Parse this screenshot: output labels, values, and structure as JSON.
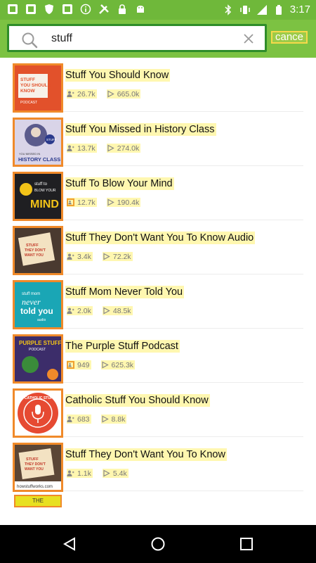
{
  "status_bar": {
    "time": "3:17",
    "left_icons": [
      "app-notification-icon",
      "app-notification-icon",
      "shield-icon",
      "app-notification-icon",
      "info-icon",
      "tools-icon",
      "lock-icon",
      "android-icon"
    ],
    "right_icons": [
      "bluetooth-icon",
      "vibrate-icon",
      "signal-icon",
      "battery-icon"
    ]
  },
  "search": {
    "query": "stuff",
    "cancel_label": "cance",
    "accent": "#7cc242",
    "border": "#2f8d2a"
  },
  "results": [
    {
      "title": "Stuff You Should Know",
      "subscribers": "26.7k",
      "plays": "665.0k",
      "art": {
        "bg": "#e2512b",
        "text": "STUFF YOU SHOULD KNOW"
      }
    },
    {
      "title": "Stuff You Missed in History Class",
      "subscribers": "13.7k",
      "plays": "274.0k",
      "art": {
        "bg": "#d9d4e8",
        "text": "HISTORY CLASS"
      }
    },
    {
      "title": "Stuff To Blow Your Mind",
      "subscribers": "12.7k",
      "plays": "190.4k",
      "art": {
        "bg": "#1f1f22",
        "text": "MIND"
      }
    },
    {
      "title": "Stuff They Don't Want You To Know Audio",
      "subscribers": "3.4k",
      "plays": "72.2k",
      "art": {
        "bg": "#4a3a30",
        "text": "STUFF THEY DON'T WANT YOU TO KNOW"
      }
    },
    {
      "title": "Stuff Mom Never Told You",
      "subscribers": "2.0k",
      "plays": "48.5k",
      "art": {
        "bg": "#1aa6b5",
        "text": "never told you"
      }
    },
    {
      "title": "The Purple Stuff Podcast",
      "subscribers": "949",
      "plays": "625.3k",
      "art": {
        "bg": "#3c2d6a",
        "text": "PURPLE STUFF"
      }
    },
    {
      "title": "Catholic Stuff You Should Know",
      "subscribers": "683",
      "plays": "8.8k",
      "art": {
        "bg": "#e64a32",
        "text": "CATHOLIC STUFF"
      }
    },
    {
      "title": "Stuff They Don't Want You To Know",
      "subscribers": "1.1k",
      "plays": "5.4k",
      "art": {
        "bg": "#5b4636",
        "text": "STUFF THEY DON'T WANT YOU TO KNOW"
      }
    }
  ],
  "partial_item": {
    "label": "THE"
  },
  "nav_bar": {
    "buttons": [
      "back-icon",
      "home-icon",
      "recents-icon"
    ]
  }
}
